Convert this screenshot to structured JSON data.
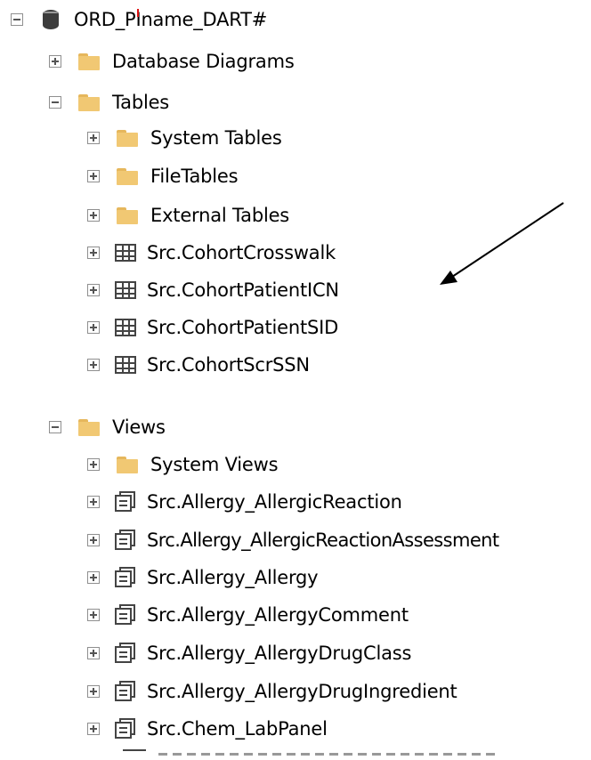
{
  "tree": {
    "root": {
      "label": "ORD_PIname_DART#",
      "icon": "database-icon",
      "expanded": true
    },
    "items": [
      {
        "label": "Database Diagrams",
        "icon": "folder-icon",
        "toggle": "plus"
      },
      {
        "label": "Tables",
        "icon": "folder-icon",
        "toggle": "minus"
      },
      {
        "label": "System Tables",
        "icon": "folder-icon",
        "toggle": "plus"
      },
      {
        "label": "FileTables",
        "icon": "folder-icon",
        "toggle": "plus"
      },
      {
        "label": "External Tables",
        "icon": "folder-icon",
        "toggle": "plus"
      },
      {
        "label": "Src.CohortCrosswalk",
        "icon": "table-icon",
        "toggle": "plus"
      },
      {
        "label": "Src.CohortPatientICN",
        "icon": "table-icon",
        "toggle": "plus"
      },
      {
        "label": "Src.CohortPatientSID",
        "icon": "table-icon",
        "toggle": "plus"
      },
      {
        "label": "Src.CohortScrSSN",
        "icon": "table-icon",
        "toggle": "plus"
      },
      {
        "label": "Views",
        "icon": "folder-icon",
        "toggle": "minus"
      },
      {
        "label": "System Views",
        "icon": "folder-icon",
        "toggle": "plus"
      },
      {
        "label": "Src.Allergy_AllergicReaction",
        "icon": "view-icon",
        "toggle": "plus"
      },
      {
        "label": "Src.Allergy_AllergicReactionAssessment",
        "icon": "view-icon",
        "toggle": "plus"
      },
      {
        "label": "Src.Allergy_Allergy",
        "icon": "view-icon",
        "toggle": "plus"
      },
      {
        "label": "Src.Allergy_AllergyComment",
        "icon": "view-icon",
        "toggle": "plus"
      },
      {
        "label": "Src.Allergy_AllergyDrugClass",
        "icon": "view-icon",
        "toggle": "plus"
      },
      {
        "label": "Src.Allergy_AllergyDrugIngredient",
        "icon": "view-icon",
        "toggle": "plus"
      },
      {
        "label": "Src.Chem_LabPanel",
        "icon": "view-icon",
        "toggle": "plus"
      }
    ]
  },
  "annotation": {
    "type": "arrow",
    "points_to": "Src.CohortPatientICN",
    "color": "#000000"
  }
}
